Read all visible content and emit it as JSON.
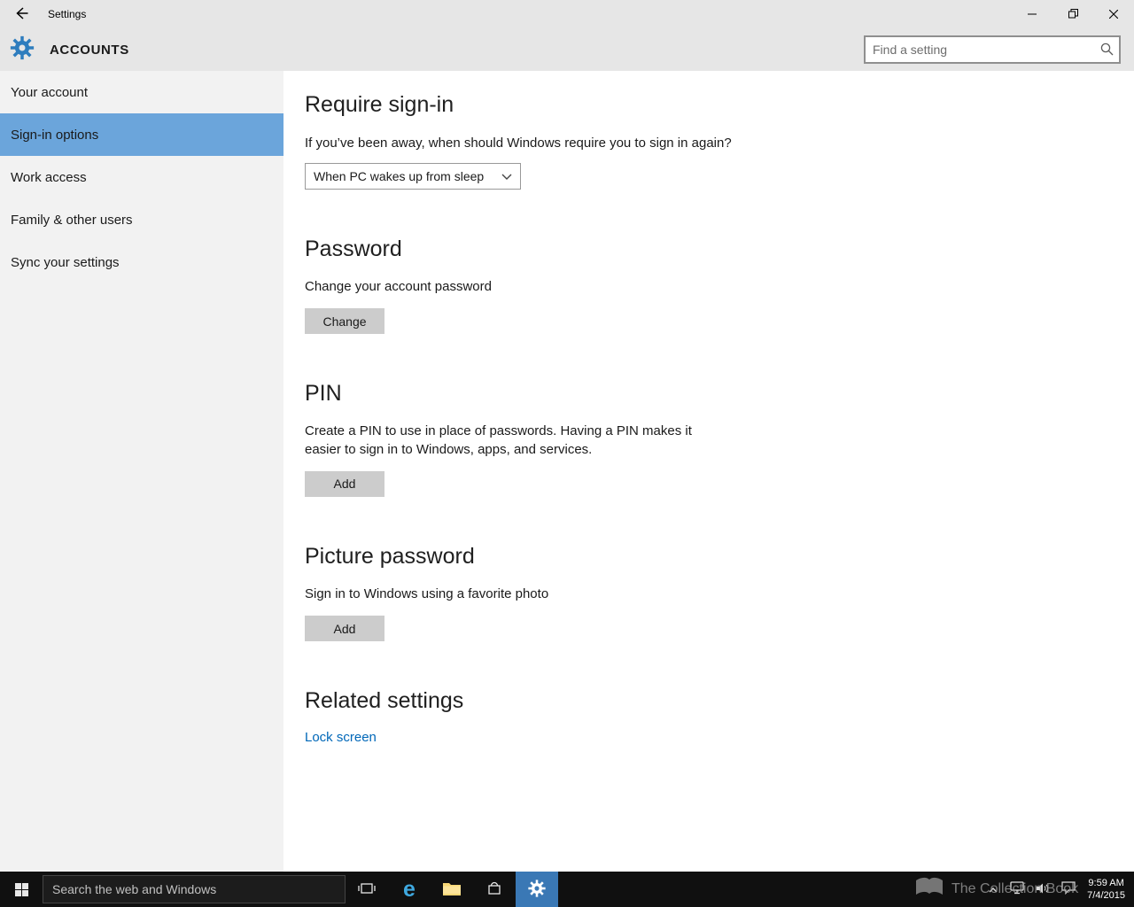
{
  "window": {
    "title": "Settings"
  },
  "header": {
    "page_title": "ACCOUNTS",
    "search_placeholder": "Find a setting"
  },
  "sidebar": {
    "items": [
      {
        "label": "Your account",
        "selected": false
      },
      {
        "label": "Sign-in options",
        "selected": true
      },
      {
        "label": "Work access",
        "selected": false
      },
      {
        "label": "Family & other users",
        "selected": false
      },
      {
        "label": "Sync your settings",
        "selected": false
      }
    ]
  },
  "main": {
    "require_signin": {
      "title": "Require sign-in",
      "question": "If you’ve been away, when should Windows require you to sign in again?",
      "dropdown_value": "When PC wakes up from sleep"
    },
    "password": {
      "title": "Password",
      "description": "Change your account password",
      "button_label": "Change"
    },
    "pin": {
      "title": "PIN",
      "description": "Create a PIN to use in place of passwords. Having a PIN makes it easier to sign in to Windows, apps, and services.",
      "button_label": "Add"
    },
    "picture_password": {
      "title": "Picture password",
      "description": "Sign in to Windows using a favorite photo",
      "button_label": "Add"
    },
    "related_settings": {
      "title": "Related settings",
      "link_label": "Lock screen"
    }
  },
  "taskbar": {
    "search_placeholder": "Search the web and Windows",
    "clock": {
      "time": "9:59 AM",
      "date": "7/4/2015"
    }
  },
  "watermark": {
    "text": "The Collection Book"
  },
  "colors": {
    "accent_selection": "#6BA5DB",
    "link": "#0067B8",
    "taskbar_background": "#101010",
    "active_app_tile": "#3A78B5"
  }
}
